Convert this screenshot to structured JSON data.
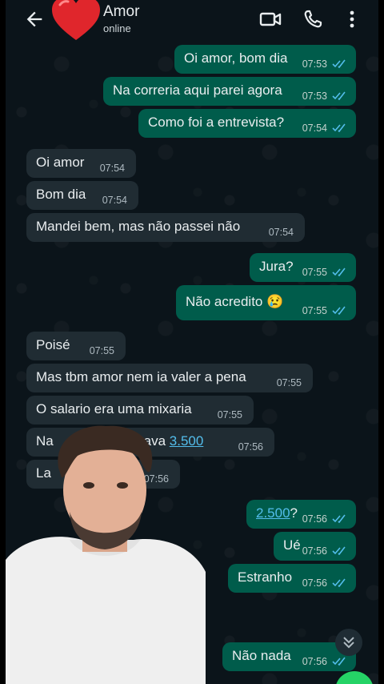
{
  "header": {
    "contact_name": "Amor",
    "status": "online"
  },
  "messages": [
    {
      "dir": "out",
      "text": "Oi amor, bom dia",
      "time": "07:53"
    },
    {
      "dir": "out",
      "text": "Na correria aqui parei agora",
      "time": "07:53"
    },
    {
      "dir": "out",
      "text": "Como foi a entrevista?",
      "time": "07:54"
    },
    {
      "dir": "in",
      "text": "Oi amor",
      "time": "07:54"
    },
    {
      "dir": "in",
      "text": "Bom dia",
      "time": "07:54"
    },
    {
      "dir": "in",
      "text": "Mandei bem, mas não passei não",
      "time": "07:54"
    },
    {
      "dir": "out",
      "text": "Jura?",
      "time": "07:55"
    },
    {
      "dir": "out",
      "text": "Não acredito",
      "emoji": "😢",
      "time": "07:55"
    },
    {
      "dir": "in",
      "text": "Poisé",
      "time": "07:55"
    },
    {
      "dir": "in",
      "text": "Mas tbm amor nem ia valer a pena",
      "time": "07:55"
    },
    {
      "dir": "in",
      "text": "O salario era uma mixaria",
      "time": "07:55"
    },
    {
      "dir": "in",
      "text_start": "Na",
      "text_mid": "nhava",
      "link": "3.500",
      "time": "07:56"
    },
    {
      "dir": "in",
      "text": "La",
      "time": "07:56"
    },
    {
      "dir": "out",
      "link": "2.500",
      "text": "?",
      "time": "07:56"
    },
    {
      "dir": "out",
      "text": "Ué",
      "time": "07:56"
    },
    {
      "dir": "out",
      "text": "Estranho",
      "time": "07:56"
    },
    {
      "dir": "out",
      "text": "Não nada",
      "time": "07:56"
    }
  ],
  "colors": {
    "background": "#0b141a",
    "outgoing_bubble": "#005c4b",
    "incoming_bubble": "#202c33",
    "read_ticks": "#53bdeb"
  },
  "icons": [
    "back-arrow-icon",
    "heart-avatar-icon",
    "video-call-icon",
    "phone-call-icon",
    "more-options-icon",
    "double-check-icon",
    "scroll-down-icon"
  ]
}
